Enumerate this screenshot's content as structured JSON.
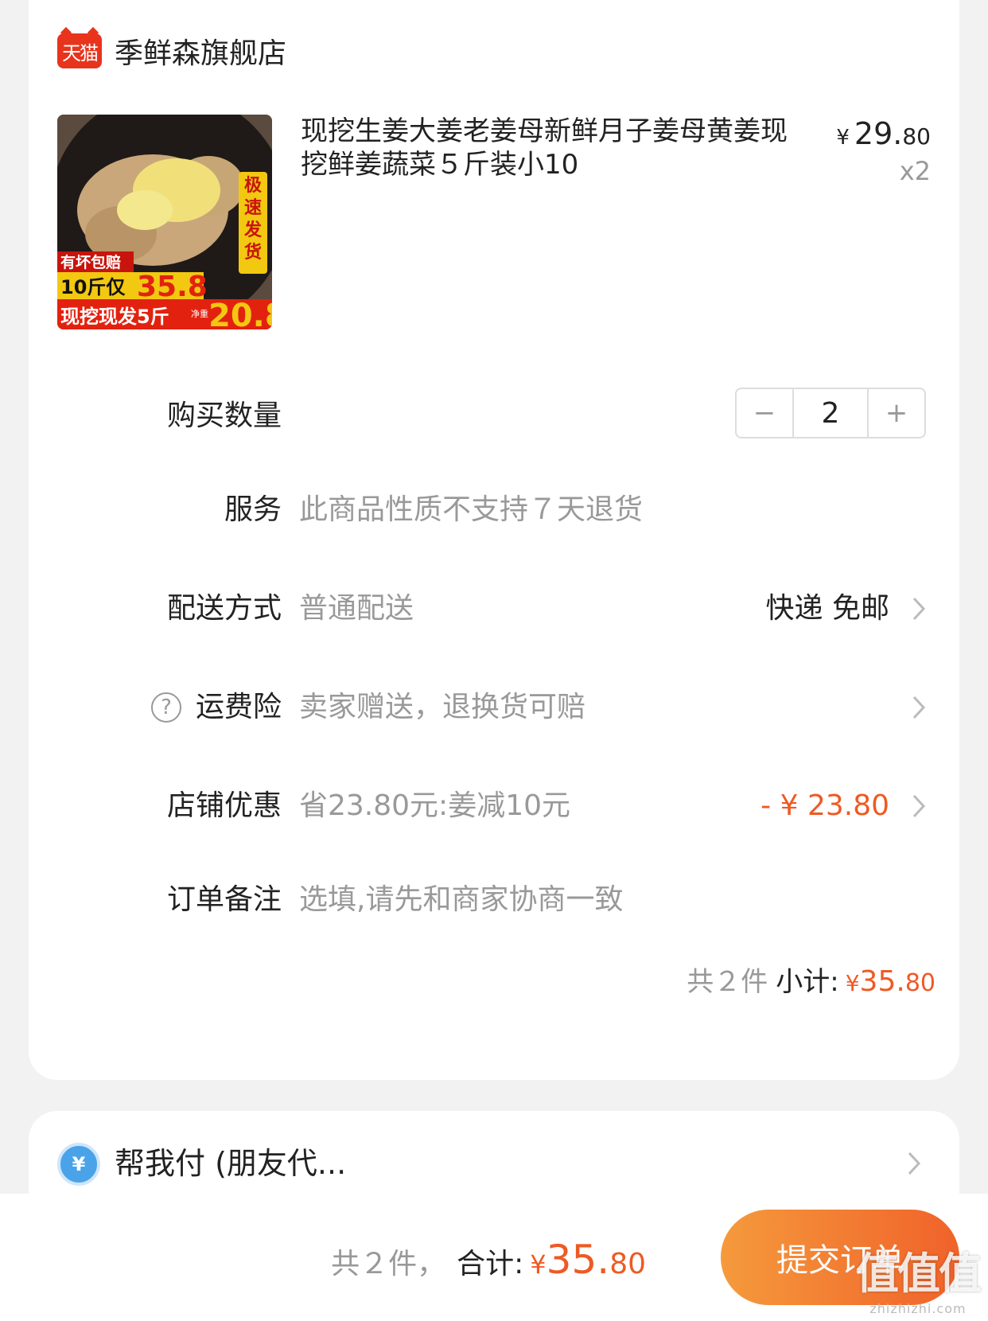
{
  "store": {
    "badge": "天猫",
    "name": "季鲜森旗舰店"
  },
  "product": {
    "title": "现挖生姜大姜老姜母新鲜月子姜母黄姜现挖鲜姜蔬菜５斤装小10",
    "price_currency": "¥",
    "price_int": "29.",
    "price_dec": "80",
    "quantity_text": "x2",
    "thumb": {
      "badge_fast": "极速发货",
      "tag_guarantee": "有坏包赔",
      "line1_label": "10斤仅",
      "line1_price": "35.8",
      "line2_label": "现挖现发5斤",
      "line2_net": "净重",
      "line2_price": "20.8"
    }
  },
  "rows": {
    "quantity": {
      "label": "购买数量",
      "minus": "−",
      "value": "2",
      "plus": "+"
    },
    "service": {
      "label": "服务",
      "value": "此商品性质不支持７天退货"
    },
    "delivery": {
      "label": "配送方式",
      "value": "普通配送",
      "right": "快递 免邮"
    },
    "insurance": {
      "label": "运费险",
      "help": "?",
      "value": "卖家赠送，退换货可赔"
    },
    "discount": {
      "label": "店铺优惠",
      "value": "省23.80元:姜减10元",
      "right": "- ¥ 23.80"
    },
    "note": {
      "label": "订单备注",
      "placeholder": "选填,请先和商家协商一致"
    }
  },
  "subtotal": {
    "count": "共２件",
    "label": "小计:",
    "currency": "¥",
    "int": "35.",
    "dec": "80"
  },
  "pay": {
    "icon": "¥",
    "label": "帮我付 (朋友代..."
  },
  "footer": {
    "count": "共２件，",
    "label": "合计:",
    "currency": "¥",
    "int": "35.",
    "dec": "80",
    "submit": "提交订单"
  },
  "watermark": {
    "main": "值值值",
    "sub": "zhizhizhi.com"
  },
  "colors": {
    "accent": "#ee5a24",
    "tmall_red": "#e8341c",
    "button_start": "#f59a3c",
    "button_end": "#f0622a"
  }
}
